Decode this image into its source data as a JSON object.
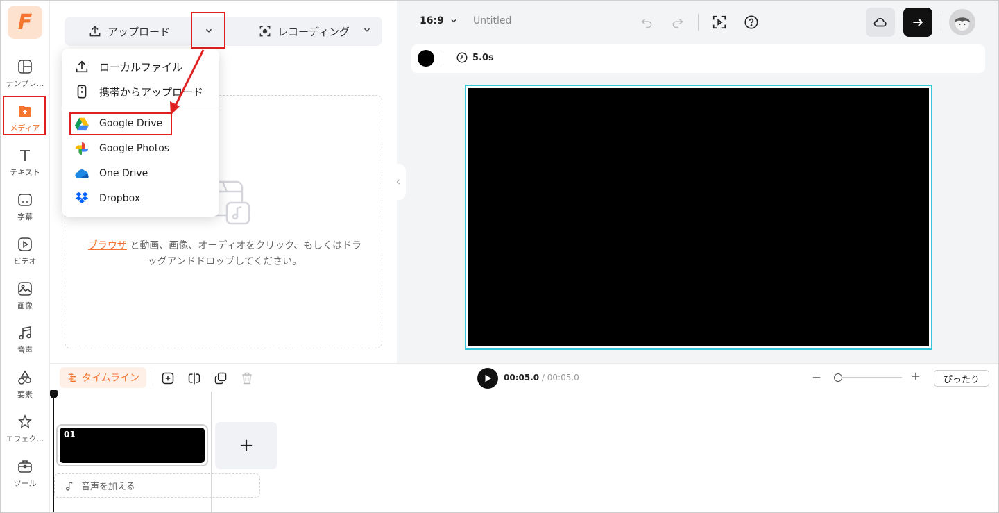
{
  "sidebar": {
    "logo_letter": "F",
    "items": [
      {
        "label": "テンプレ…",
        "icon": "template-icon"
      },
      {
        "label": "メディア",
        "icon": "media-folder-icon",
        "active": true
      },
      {
        "label": "テキスト",
        "icon": "text-icon"
      },
      {
        "label": "字幕",
        "icon": "subtitle-icon"
      },
      {
        "label": "ビデオ",
        "icon": "video-icon"
      },
      {
        "label": "画像",
        "icon": "image-icon"
      },
      {
        "label": "音声",
        "icon": "music-icon"
      },
      {
        "label": "要素",
        "icon": "elements-icon"
      },
      {
        "label": "エフェク…",
        "icon": "effects-icon"
      },
      {
        "label": "ツール",
        "icon": "toolbox-icon"
      }
    ]
  },
  "media_panel": {
    "upload_label": "アップロード",
    "recording_label": "レコーディング",
    "drop_link": "ブラウザ",
    "drop_text": " と動画、画像、オーディオをクリック、もしくはドラッグアンドドロップしてください。"
  },
  "upload_menu": {
    "items": [
      {
        "label": "ローカルファイル",
        "icon": "upload-icon"
      },
      {
        "label": "携帯からアップロード",
        "icon": "phone-icon"
      },
      {
        "label": "Google Drive",
        "icon": "google-drive-icon"
      },
      {
        "label": "Google Photos",
        "icon": "google-photos-icon"
      },
      {
        "label": "One Drive",
        "icon": "onedrive-icon"
      },
      {
        "label": "Dropbox",
        "icon": "dropbox-icon"
      }
    ]
  },
  "editor": {
    "aspect_ratio": "16:9",
    "project_title": "Untitled",
    "duration": "5.0s",
    "background_color": "#000000",
    "selection_color": "#35c6dc"
  },
  "timeline": {
    "tab_label": "タイムライン",
    "current_time": "00:05.0",
    "separator": " / ",
    "total_time": "00:05.0",
    "fit_label": "ぴったり",
    "clip_number": "01",
    "add_clip": "+",
    "add_audio_label": "音声を加える"
  },
  "colors": {
    "accent": "#f47430",
    "highlight": "#e02020"
  }
}
